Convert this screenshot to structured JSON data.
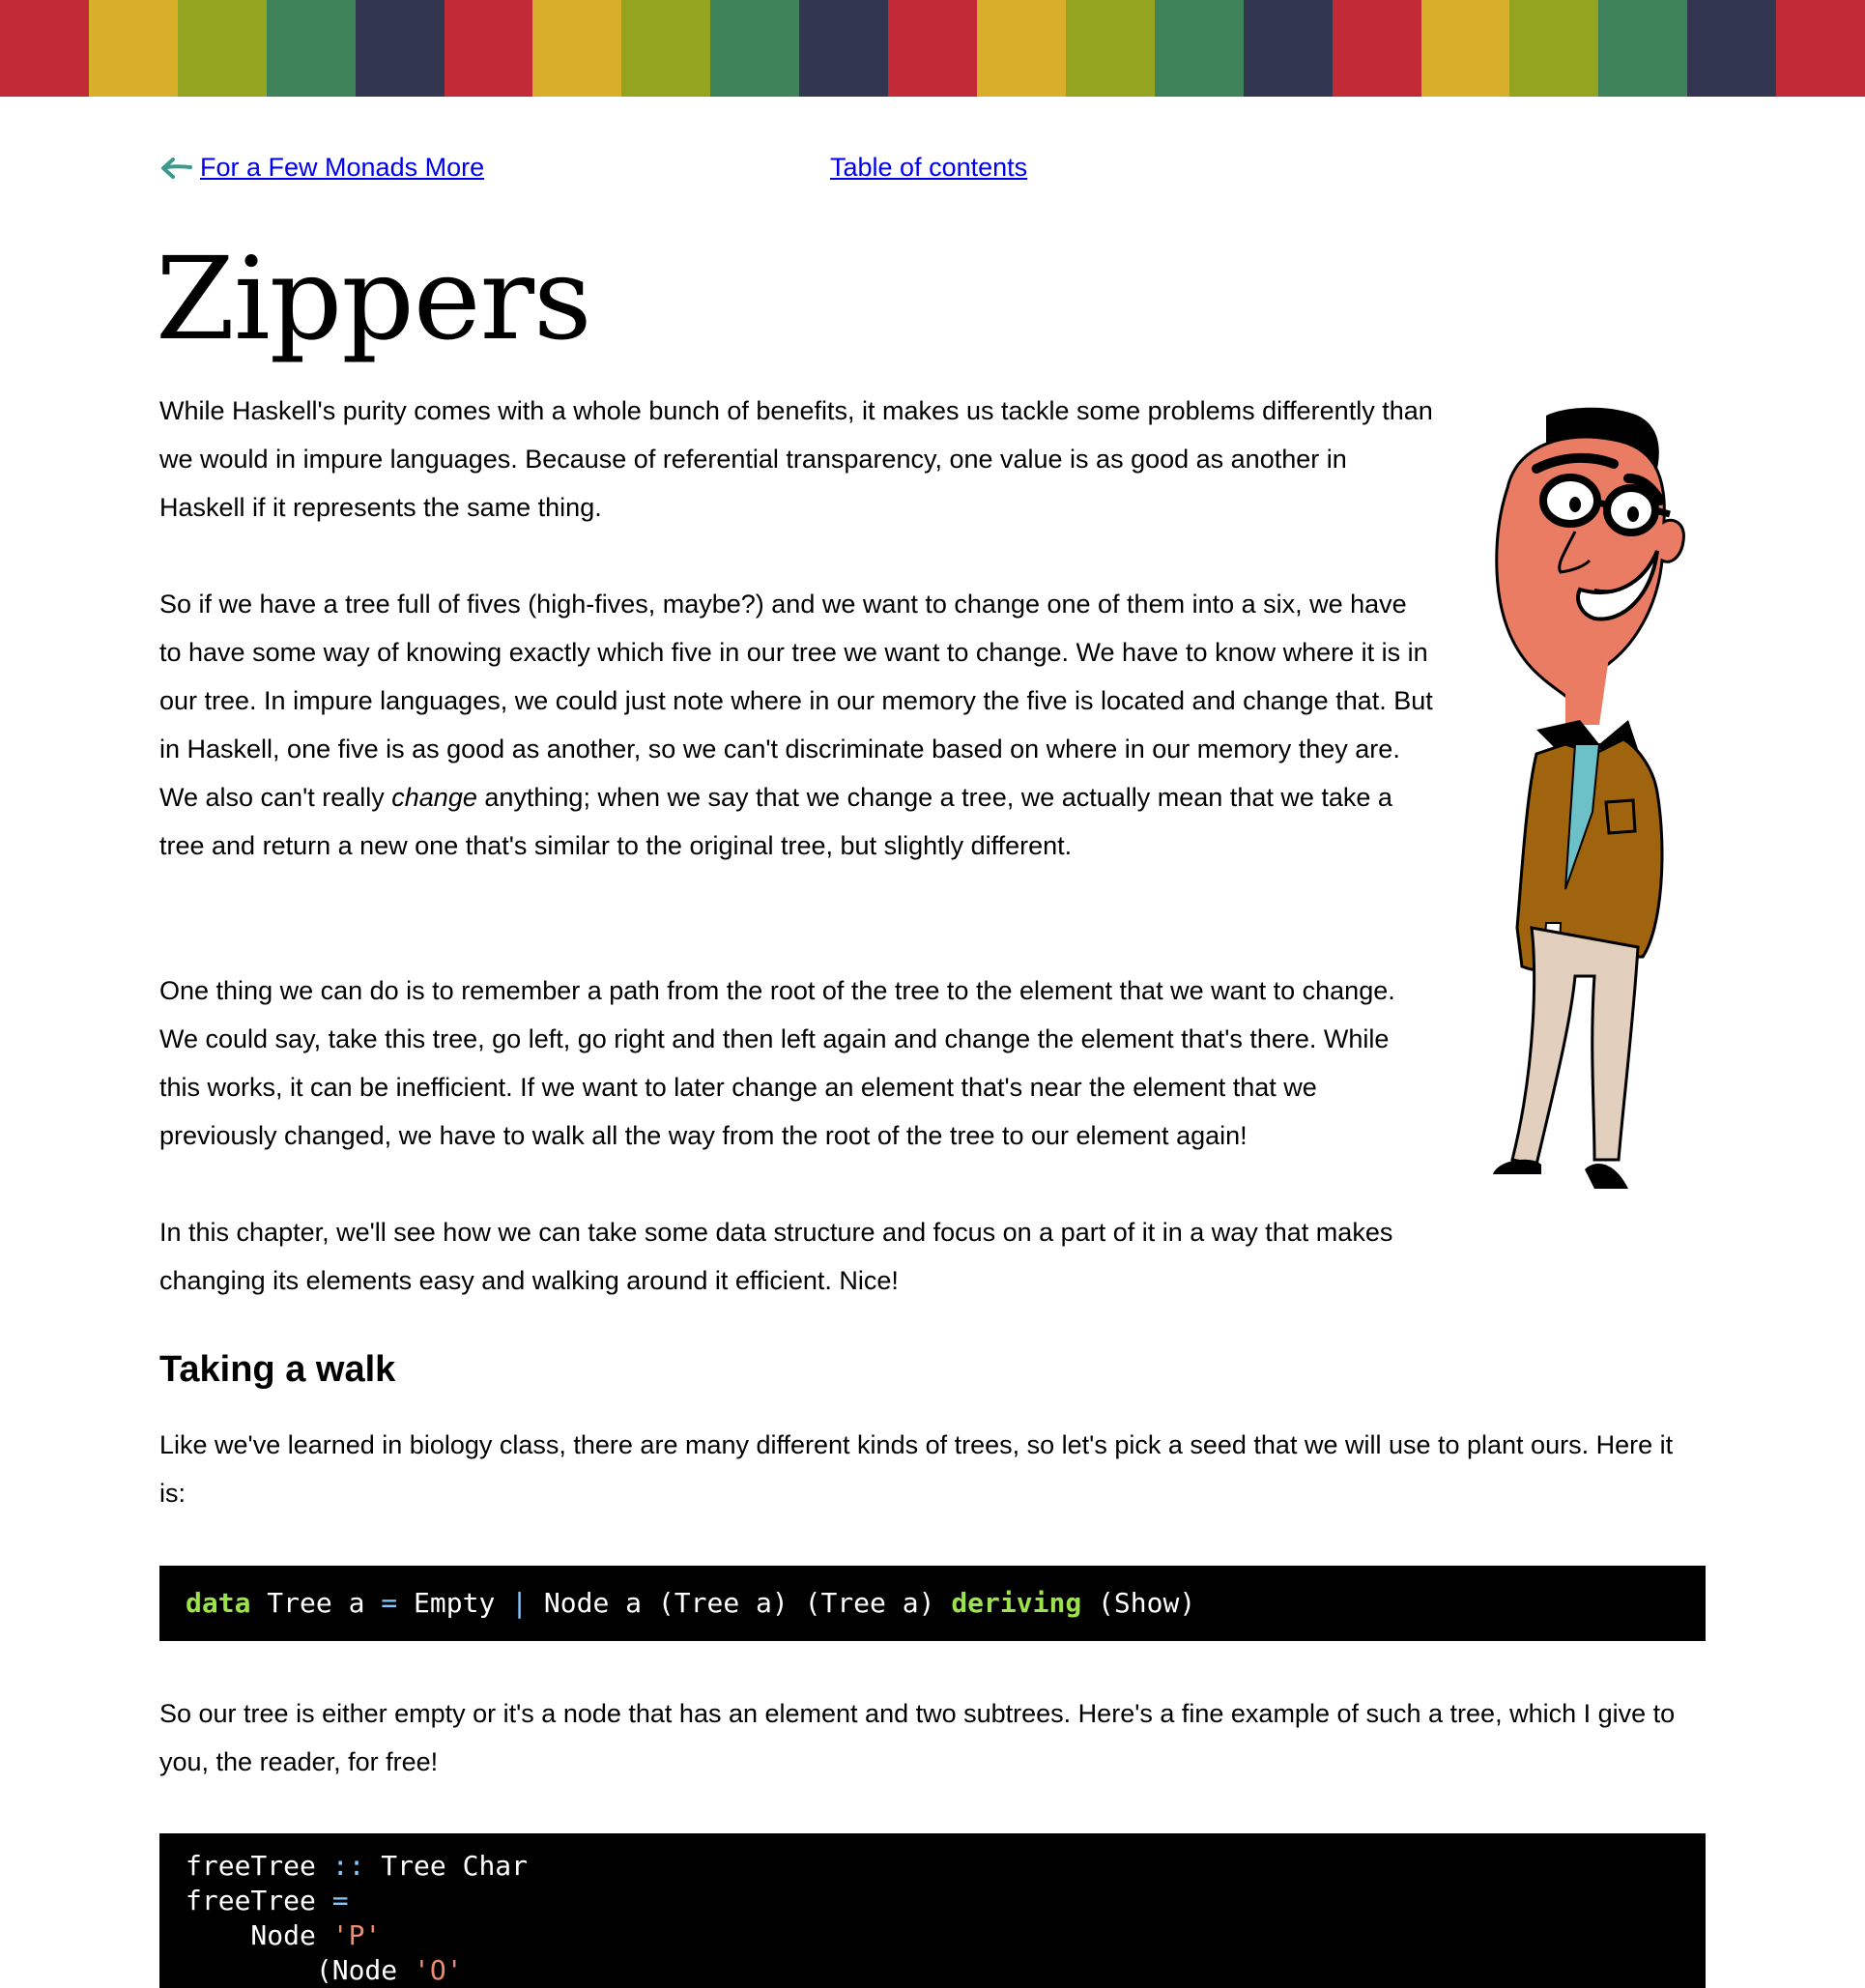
{
  "stripe_colors": [
    "#c22a36",
    "#d8ae2b",
    "#94a421",
    "#3f835a",
    "#333650",
    "#c22a36",
    "#d8ae2b",
    "#94a421",
    "#3f835a",
    "#333650",
    "#c22a36",
    "#d8ae2b",
    "#94a421",
    "#3f835a",
    "#333650",
    "#c22a36",
    "#d8ae2b",
    "#94a421",
    "#3f835a",
    "#333650",
    "#c22a36"
  ],
  "nav": {
    "prev_label": "For a Few Monads More",
    "toc_label": "Table of contents"
  },
  "page_title": "Zippers",
  "paragraphs": {
    "p1": "While Haskell's purity comes with a whole bunch of benefits, it makes us tackle some problems differently than we would in impure languages. Because of referential transparency, one value is as good as another in Haskell if it represents the same thing.",
    "p2_before": "So if we have a tree full of fives (high-fives, maybe?) and we want to change one of them into a six, we have to have some way of knowing exactly which five in our tree we want to change. We have to know where it is in our tree. In impure languages, we could just note where in our memory the five is located and change that. But in Haskell, one five is as good as another, so we can't discriminate based on where in our memory they are. We also can't really ",
    "p2_em": "change",
    "p2_after": " anything; when we say that we change a tree, we actually mean that we take a tree and return a new one that's similar to the original tree, but slightly different.",
    "p3": "One thing we can do is to remember a path from the root of the tree to the element that we want to change. We could say, take this tree, go left, go right and then left again and change the element that's there. While this works, it can be inefficient. If we want to later change an element that's near the element that we previously changed, we have to walk all the way from the root of the tree to our element again!",
    "p4": "In this chapter, we'll see how we can take some data structure and focus on a part of it in a way that makes changing its elements easy and walking around it efficient. Nice!",
    "p5": "Like we've learned in biology class, there are many different kinds of trees, so let's pick a seed that we will use to plant ours. Here it is:",
    "p6": "So our tree is either empty or it's a node that has an element and two subtrees. Here's a fine example of such a tree, which I give to you, the reader, for free!"
  },
  "section_heading": "Taking a walk",
  "code1": {
    "kw_data": "data",
    "t1": " Tree a ",
    "eq": "=",
    "t2": " Empty ",
    "bar": "|",
    "t3": " Node a (Tree a) (Tree a) ",
    "kw_deriving": "deriving",
    "t4": " (Show)"
  },
  "code2": {
    "l1_a": "freeTree ",
    "l1_op": "::",
    "l1_b": " Tree Char",
    "l2_a": "freeTree ",
    "l2_op": "=",
    "l3_a": "    Node ",
    "l3_str": "'P'",
    "l4_a": "        (Node ",
    "l4_str": "'O'"
  }
}
